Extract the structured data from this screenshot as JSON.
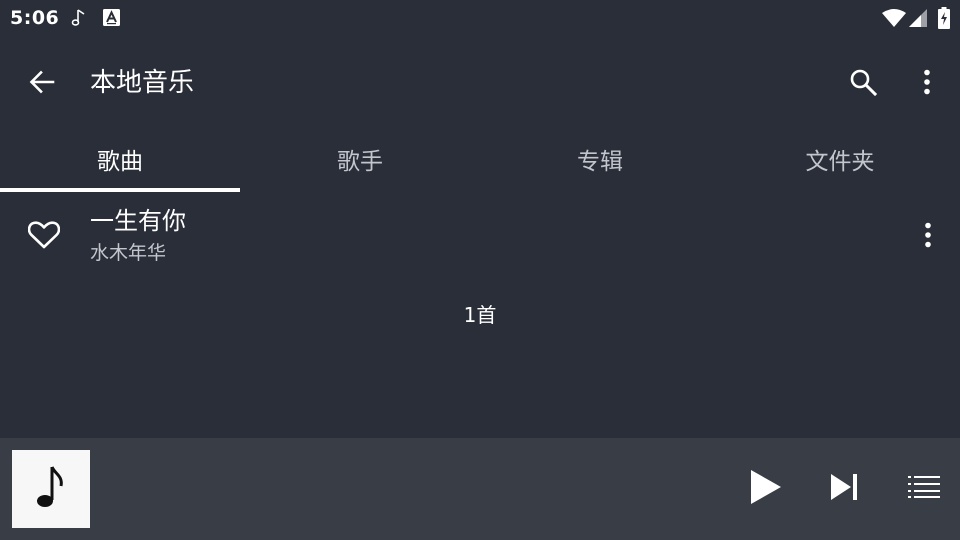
{
  "status_bar": {
    "time": "5:06",
    "notification_icons": [
      "music-note-icon",
      "font-app-icon"
    ],
    "system_icons": [
      "wifi-icon",
      "signal-icon",
      "battery-charging-icon"
    ]
  },
  "toolbar": {
    "title": "本地音乐",
    "back_icon": "arrow-back-icon",
    "search_icon": "search-icon",
    "more_icon": "more-vert-icon"
  },
  "tabs": [
    {
      "label": "歌曲",
      "active": true
    },
    {
      "label": "歌手",
      "active": false
    },
    {
      "label": "专辑",
      "active": false
    },
    {
      "label": "文件夹",
      "active": false
    }
  ],
  "songs": [
    {
      "title": "一生有你",
      "artist": "水木年华",
      "favorite_icon": "heart-outline-icon",
      "more_icon": "more-vert-icon"
    }
  ],
  "song_count": "1首",
  "player": {
    "album_icon": "music-note-icon",
    "play_icon": "play-icon",
    "next_icon": "skip-next-icon",
    "playlist_icon": "playlist-icon"
  },
  "colors": {
    "background": "#2a2e38",
    "player_background": "#393d46",
    "primary_text": "#ffffff",
    "secondary_text": "#c3c6cd",
    "album_background": "#f7f7f7"
  }
}
